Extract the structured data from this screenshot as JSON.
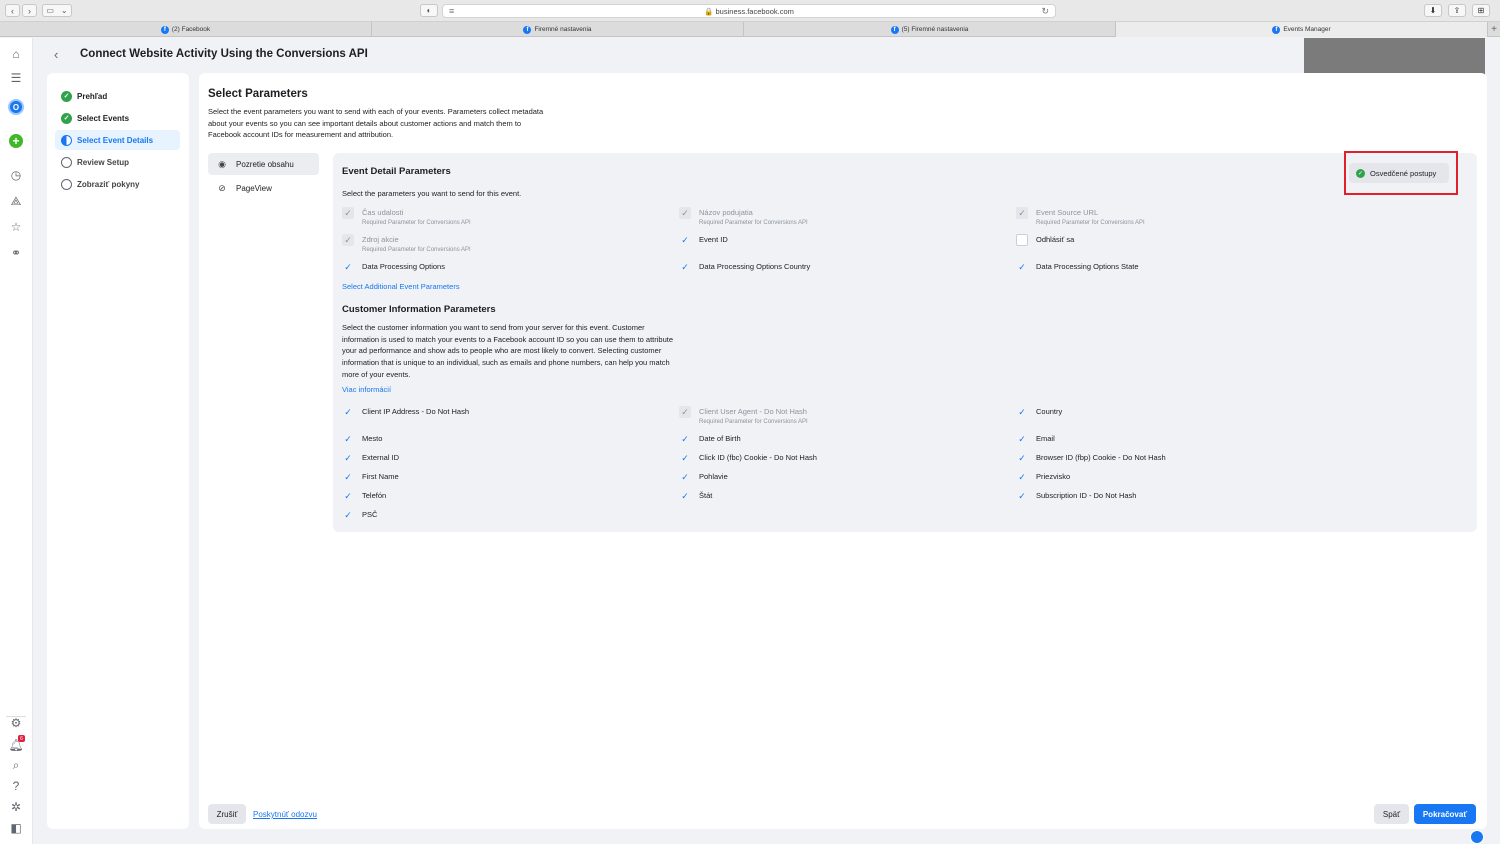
{
  "browser": {
    "url": "business.facebook.com",
    "tabs": [
      {
        "label": "(2) Facebook"
      },
      {
        "label": "Firemné nastavenia"
      },
      {
        "label": "(5) Firemné nastavenia"
      },
      {
        "label": "Events Manager"
      }
    ],
    "new_tab": "+"
  },
  "rail": {
    "avatar_letter": "O",
    "notification_count": "6",
    "icons": [
      "home-icon",
      "menu-icon",
      "account-avatar",
      "create-icon",
      "overview-icon",
      "data-sources-icon",
      "partner-icon",
      "diagnostics-icon",
      "settings-icon",
      "notifications-icon",
      "search-icon",
      "help-icon",
      "bug-icon",
      "sidebar-icon"
    ]
  },
  "header": {
    "title": "Connect Website Activity Using the Conversions API"
  },
  "steps": [
    {
      "label": "Prehľad",
      "state": "done"
    },
    {
      "label": "Select Events",
      "state": "done"
    },
    {
      "label": "Select Event Details",
      "state": "current"
    },
    {
      "label": "Review Setup",
      "state": "pending"
    },
    {
      "label": "Zobraziť pokyny",
      "state": "pending"
    }
  ],
  "main": {
    "title": "Select Parameters",
    "description": "Select the event parameters you want to send with each of your events. Parameters collect metadata about your events so you can see important details about customer actions and match them to Facebook account IDs for measurement and attribution.",
    "events": [
      {
        "label": "Pozretie obsahu",
        "icon": "eye-icon",
        "selected": true
      },
      {
        "label": "PageView",
        "icon": "tag-icon",
        "selected": false
      }
    ]
  },
  "params": {
    "best_practices": "Osvedčené postupy",
    "event_detail": {
      "title": "Event Detail Parameters",
      "subtitle": "Select the parameters you want to send for this event.",
      "required_note": "Required Parameter for Conversions API",
      "items": [
        {
          "label": "Čas udalosti",
          "state": "dis",
          "required": true
        },
        {
          "label": "Názov podujatia",
          "state": "dis",
          "required": true
        },
        {
          "label": "Event Source URL",
          "state": "dis",
          "required": true
        },
        {
          "label": "Zdroj akcie",
          "state": "dis",
          "required": true
        },
        {
          "label": "Event ID",
          "state": "on",
          "required": false
        },
        {
          "label": "Odhlásiť sa",
          "state": "off",
          "required": false
        },
        {
          "label": "Data Processing Options",
          "state": "on",
          "required": false
        },
        {
          "label": "Data Processing Options Country",
          "state": "on",
          "required": false
        },
        {
          "label": "Data Processing Options State",
          "state": "on",
          "required": false
        }
      ],
      "additional_link": "Select Additional Event Parameters"
    },
    "customer_info": {
      "title": "Customer Information Parameters",
      "description": "Select the customer information you want to send from your server for this event. Customer information is used to match your events to a Facebook account ID so you can use them to attribute your ad performance and show ads to people who are most likely to convert. Selecting customer information that is unique to an individual, such as emails and phone numbers, can help you match more of your events.",
      "more_link": "Viac informácií",
      "items": [
        {
          "label": "Client IP Address - Do Not Hash",
          "state": "on",
          "required": false
        },
        {
          "label": "Client User Agent - Do Not Hash",
          "state": "dis",
          "required": true
        },
        {
          "label": "Country",
          "state": "on",
          "required": false
        },
        {
          "label": "Mesto",
          "state": "on",
          "required": false
        },
        {
          "label": "Date of Birth",
          "state": "on",
          "required": false
        },
        {
          "label": "Email",
          "state": "on",
          "required": false
        },
        {
          "label": "External ID",
          "state": "on",
          "required": false
        },
        {
          "label": "Click ID (fbc) Cookie - Do Not Hash",
          "state": "on",
          "required": false
        },
        {
          "label": "Browser ID (fbp) Cookie - Do Not Hash",
          "state": "on",
          "required": false
        },
        {
          "label": "First Name",
          "state": "on",
          "required": false
        },
        {
          "label": "Pohlavie",
          "state": "on",
          "required": false
        },
        {
          "label": "Priezvisko",
          "state": "on",
          "required": false
        },
        {
          "label": "Telefón",
          "state": "on",
          "required": false
        },
        {
          "label": "Štát",
          "state": "on",
          "required": false
        },
        {
          "label": "Subscription ID - Do Not Hash",
          "state": "on",
          "required": false
        },
        {
          "label": "PSČ",
          "state": "on",
          "required": false
        }
      ]
    }
  },
  "footer": {
    "cancel": "Zrušiť",
    "feedback": "Poskytnúť odozvu",
    "back": "Späť",
    "continue": "Pokračovať"
  },
  "colors": {
    "accent": "#1877f2",
    "success": "#31a24c",
    "highlight": "#e0202a"
  }
}
